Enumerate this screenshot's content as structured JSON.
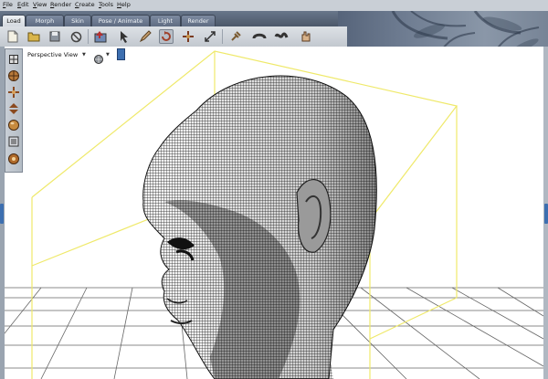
{
  "menu": [
    "File",
    "Edit",
    "View",
    "Render",
    "Create",
    "Tools",
    "Help"
  ],
  "tabs": [
    {
      "label": "Load",
      "active": true
    },
    {
      "label": "Morph",
      "active": false
    },
    {
      "label": "Skin",
      "active": false
    },
    {
      "label": "Pose / Animate",
      "active": false
    },
    {
      "label": "Light",
      "active": false
    },
    {
      "label": "Render",
      "active": false
    }
  ],
  "toolbar": {
    "tools": [
      "new-document-icon",
      "open-folder-icon",
      "save-icon",
      "no-entry-icon",
      "import-icon",
      "select-arrow-icon",
      "paint-brush-icon",
      "rotate-icon",
      "move-icon",
      "scale-icon",
      "pin-icon",
      "magnet-icon",
      "join-icon",
      "hand-icon"
    ],
    "pressed": "rotate-icon"
  },
  "viewport": {
    "label": "Perspective View",
    "camera_controls": [
      "grid-icon",
      "trackball-icon",
      "move-xy-icon",
      "move-z-icon",
      "zoom-sphere-icon",
      "frame-icon",
      "light-icon"
    ]
  },
  "colors": {
    "tab_active": "#e6e9ed",
    "toolbar": "#cfd4da",
    "bounding_box": "#f0ec6a",
    "edge_handle": "#3d6fb0"
  }
}
